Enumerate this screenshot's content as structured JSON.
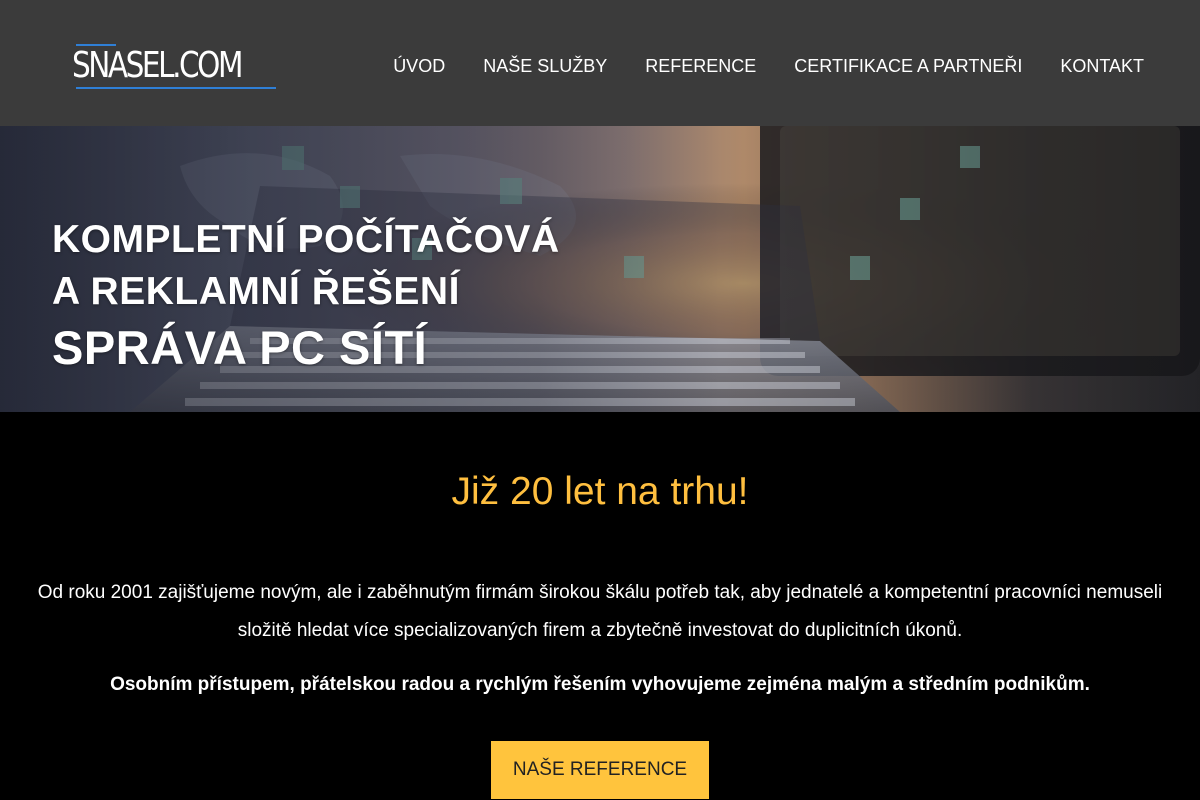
{
  "header": {
    "logo_text": "SNASEL.COM",
    "nav": [
      "ÚVOD",
      "NAŠE SLUŽBY",
      "REFERENCE",
      "CERTIFIKACE A PARTNEŘI",
      "KONTAKT"
    ]
  },
  "hero": {
    "line1": "KOMPLETNÍ POČÍTAČOVÁ",
    "line2": "A REKLAMNÍ ŘEŠENÍ",
    "line3": "SPRÁVA PC SÍTÍ"
  },
  "main": {
    "headline": "Již 20 let na trhu!",
    "paragraph": "Od roku 2001 zajišťujeme novým, ale i zaběhnutým firmám širokou škálu potřeb tak, aby jednatelé a kompetentní pracovníci nemuseli složitě hledat více specializovaných firem a zbytečně investovat do duplicitních úkonů.",
    "paragraph_bold": "Osobním přístupem, přátelskou radou a rychlým řešením vyhovujeme zejména malým a středním podnikům.",
    "cta_label": "NAŠE REFERENCE"
  },
  "colors": {
    "header_bg": "#3b3b3b",
    "accent": "#ffc43d",
    "headline": "#ffbf3f",
    "logo_blue": "#2f7fd6"
  }
}
